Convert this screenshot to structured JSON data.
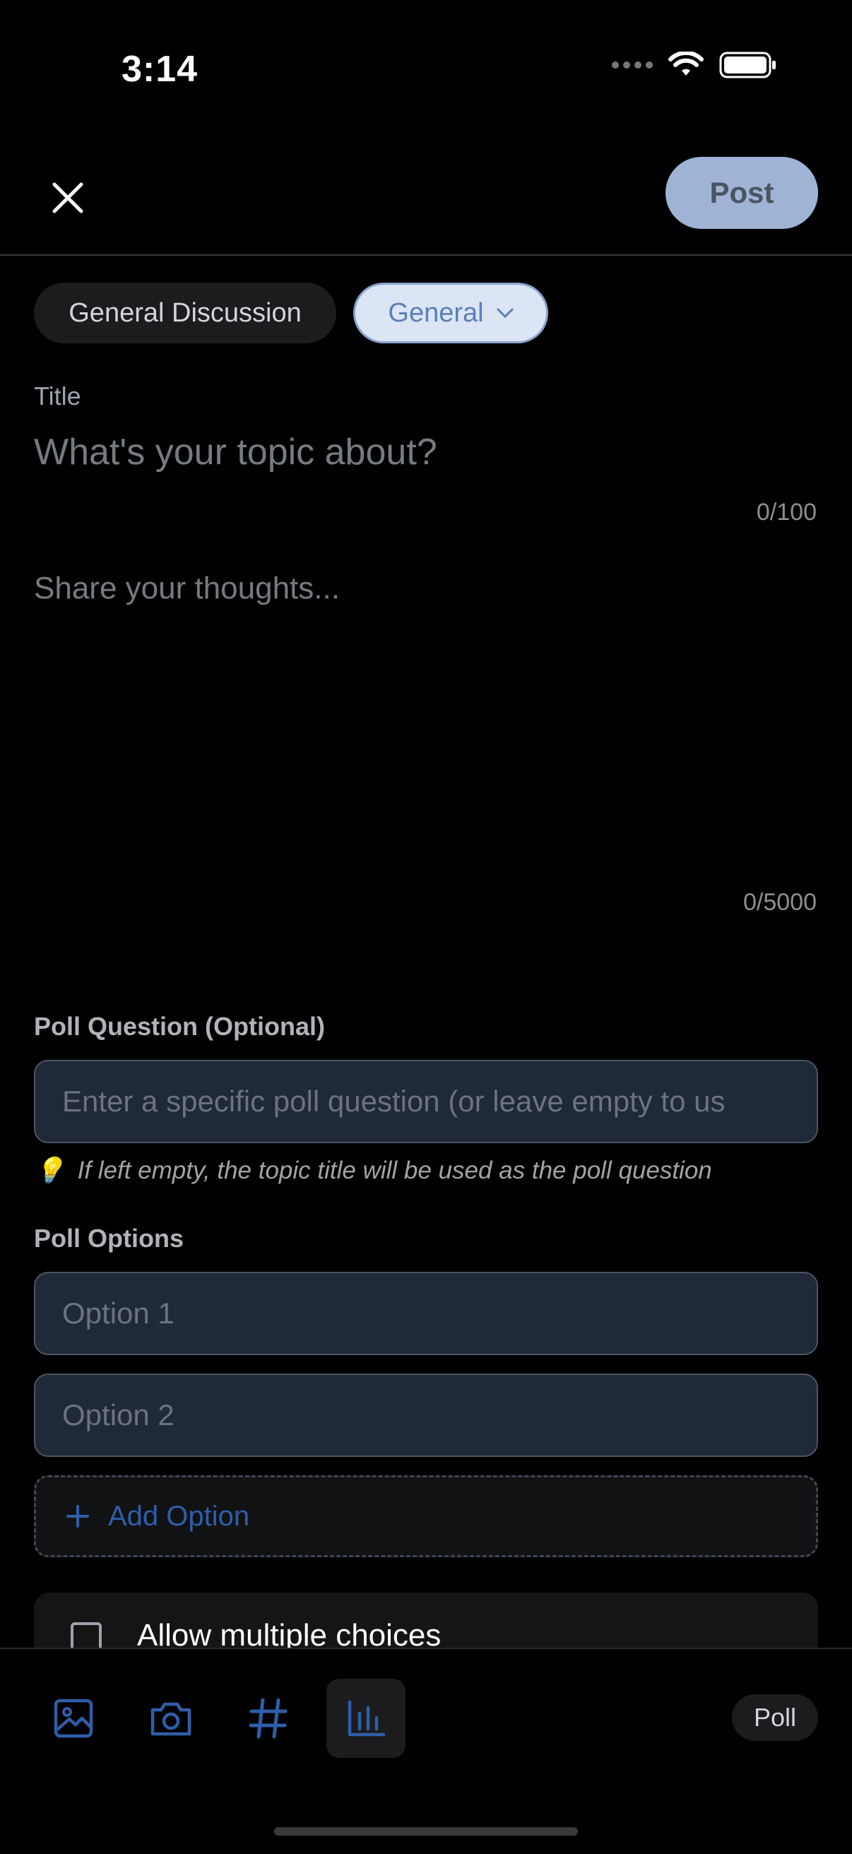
{
  "status": {
    "time": "3:14"
  },
  "nav": {
    "post_label": "Post"
  },
  "chips": {
    "category": "General Discussion",
    "subcategory": "General"
  },
  "title": {
    "label": "Title",
    "placeholder": "What's your topic about?",
    "counter": "0/100"
  },
  "body": {
    "placeholder": "Share your thoughts...",
    "counter": "0/5000"
  },
  "poll": {
    "question_label": "Poll Question (Optional)",
    "question_placeholder": "Enter a specific poll question (or leave empty to us",
    "hint_icon": "💡",
    "hint": "If left empty, the topic title will be used as the poll question",
    "options_label": "Poll Options",
    "options": [
      "Option 1",
      "Option 2"
    ],
    "add_option": "Add Option",
    "allow_multiple": "Allow multiple choices"
  },
  "toolbar": {
    "tools": [
      "image-icon",
      "camera-icon",
      "hashtag-icon",
      "poll-chart-icon"
    ],
    "mode_label": "Poll"
  },
  "colors": {
    "accent": "#2f5ea8",
    "post_button": "#9fb3d5",
    "field_bg": "#1f2937"
  }
}
